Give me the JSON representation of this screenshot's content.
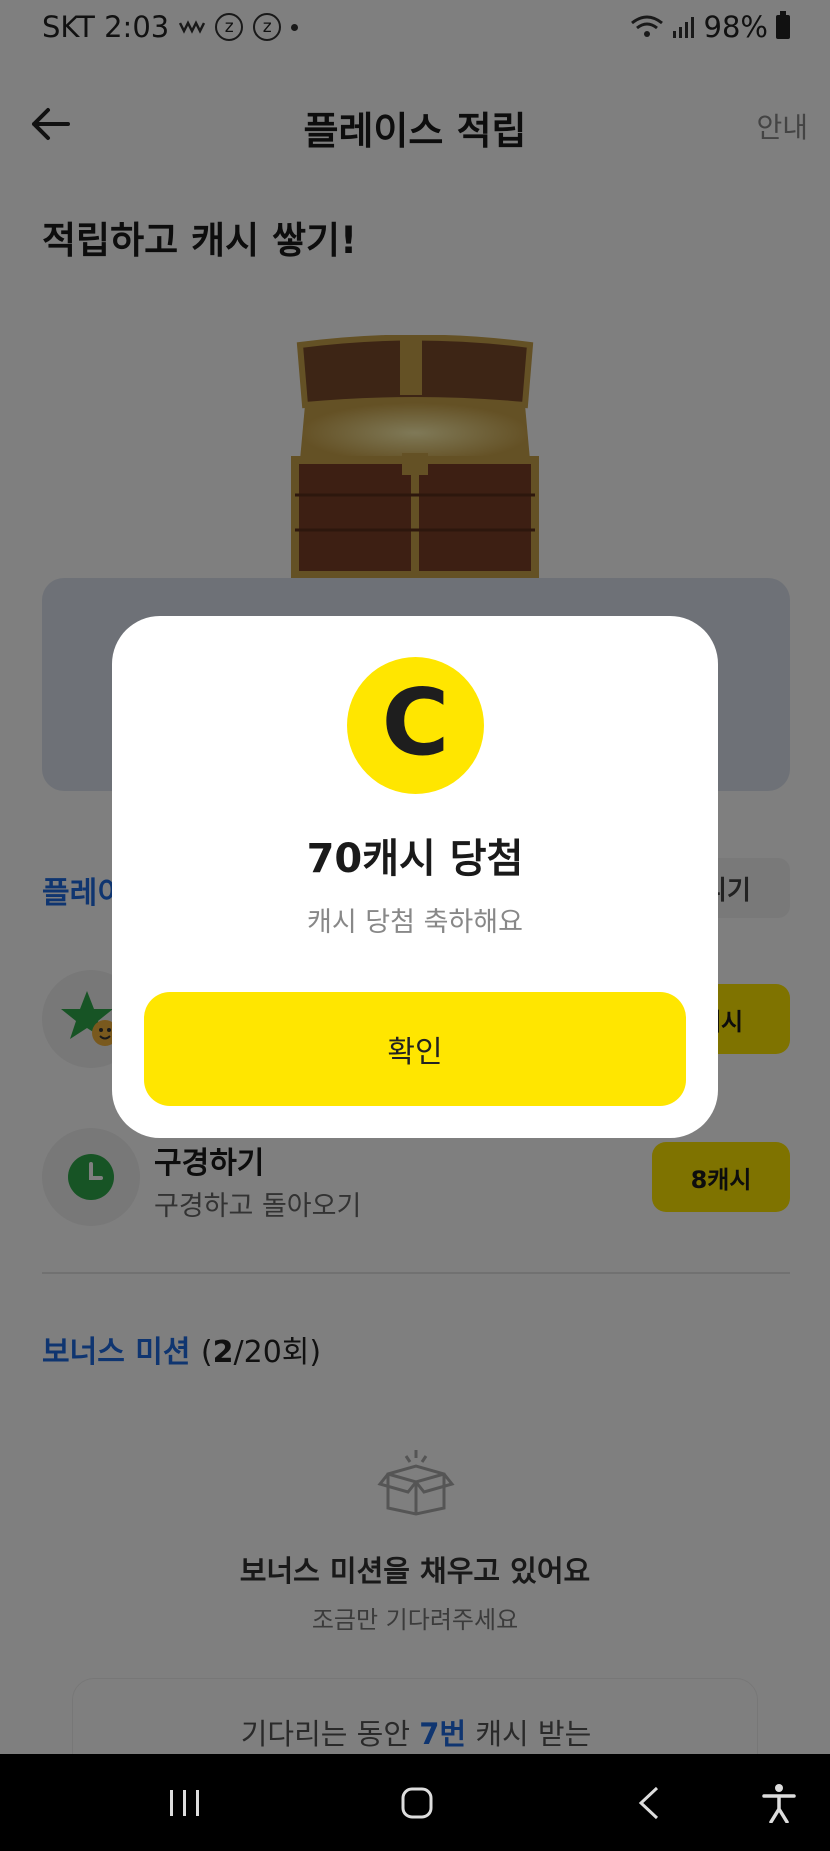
{
  "status_bar": {
    "carrier_time": "SKT 2:03",
    "notification_icons": [
      "wave-icon",
      "z-icon",
      "z-icon",
      "dot-icon"
    ],
    "battery": "98%"
  },
  "header": {
    "title": "플레이스 적립",
    "guide_label": "안내"
  },
  "heading": "적립하고 캐시 쌓기!",
  "section": {
    "title": "플레이",
    "chip_label": "늘리기"
  },
  "missions": [
    {
      "title": "",
      "subtitle": "",
      "reward": "캐시",
      "icon": "star-face-icon"
    },
    {
      "title": "구경하기",
      "subtitle": "구경하고 돌아오기",
      "reward": "8캐시",
      "icon": "clock-icon"
    }
  ],
  "bonus": {
    "title": "보너스 미션",
    "count_prefix": "(",
    "count_current": "2",
    "count_rest": "/20회)",
    "message": "보너스 미션을 채우고 있어요",
    "sub": "조금만 기다려주세요",
    "wait_prefix": "기다리는 동안 ",
    "wait_highlight": "7번",
    "wait_suffix": " 캐시 받는"
  },
  "modal": {
    "coin_letter": "C",
    "title": "70캐시 당첨",
    "subtitle": "캐시 당첨 축하해요",
    "confirm_label": "확인"
  },
  "colors": {
    "accent_yellow": "#ffe600",
    "brand_blue": "#1f6ae0"
  }
}
